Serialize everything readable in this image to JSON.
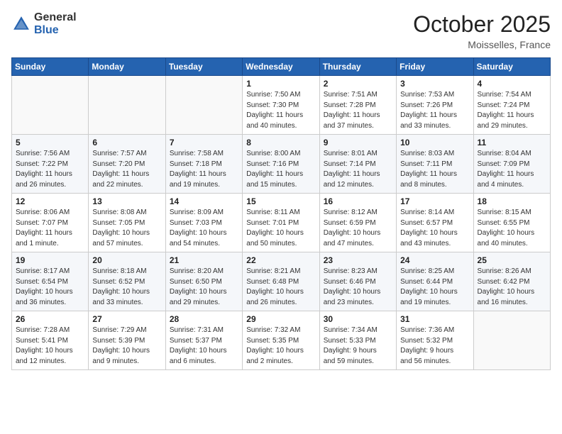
{
  "header": {
    "logo_general": "General",
    "logo_blue": "Blue",
    "month_title": "October 2025",
    "location": "Moisselles, France"
  },
  "weekdays": [
    "Sunday",
    "Monday",
    "Tuesday",
    "Wednesday",
    "Thursday",
    "Friday",
    "Saturday"
  ],
  "weeks": [
    [
      {
        "day": "",
        "info": ""
      },
      {
        "day": "",
        "info": ""
      },
      {
        "day": "",
        "info": ""
      },
      {
        "day": "1",
        "info": "Sunrise: 7:50 AM\nSunset: 7:30 PM\nDaylight: 11 hours\nand 40 minutes."
      },
      {
        "day": "2",
        "info": "Sunrise: 7:51 AM\nSunset: 7:28 PM\nDaylight: 11 hours\nand 37 minutes."
      },
      {
        "day": "3",
        "info": "Sunrise: 7:53 AM\nSunset: 7:26 PM\nDaylight: 11 hours\nand 33 minutes."
      },
      {
        "day": "4",
        "info": "Sunrise: 7:54 AM\nSunset: 7:24 PM\nDaylight: 11 hours\nand 29 minutes."
      }
    ],
    [
      {
        "day": "5",
        "info": "Sunrise: 7:56 AM\nSunset: 7:22 PM\nDaylight: 11 hours\nand 26 minutes."
      },
      {
        "day": "6",
        "info": "Sunrise: 7:57 AM\nSunset: 7:20 PM\nDaylight: 11 hours\nand 22 minutes."
      },
      {
        "day": "7",
        "info": "Sunrise: 7:58 AM\nSunset: 7:18 PM\nDaylight: 11 hours\nand 19 minutes."
      },
      {
        "day": "8",
        "info": "Sunrise: 8:00 AM\nSunset: 7:16 PM\nDaylight: 11 hours\nand 15 minutes."
      },
      {
        "day": "9",
        "info": "Sunrise: 8:01 AM\nSunset: 7:14 PM\nDaylight: 11 hours\nand 12 minutes."
      },
      {
        "day": "10",
        "info": "Sunrise: 8:03 AM\nSunset: 7:11 PM\nDaylight: 11 hours\nand 8 minutes."
      },
      {
        "day": "11",
        "info": "Sunrise: 8:04 AM\nSunset: 7:09 PM\nDaylight: 11 hours\nand 4 minutes."
      }
    ],
    [
      {
        "day": "12",
        "info": "Sunrise: 8:06 AM\nSunset: 7:07 PM\nDaylight: 11 hours\nand 1 minute."
      },
      {
        "day": "13",
        "info": "Sunrise: 8:08 AM\nSunset: 7:05 PM\nDaylight: 10 hours\nand 57 minutes."
      },
      {
        "day": "14",
        "info": "Sunrise: 8:09 AM\nSunset: 7:03 PM\nDaylight: 10 hours\nand 54 minutes."
      },
      {
        "day": "15",
        "info": "Sunrise: 8:11 AM\nSunset: 7:01 PM\nDaylight: 10 hours\nand 50 minutes."
      },
      {
        "day": "16",
        "info": "Sunrise: 8:12 AM\nSunset: 6:59 PM\nDaylight: 10 hours\nand 47 minutes."
      },
      {
        "day": "17",
        "info": "Sunrise: 8:14 AM\nSunset: 6:57 PM\nDaylight: 10 hours\nand 43 minutes."
      },
      {
        "day": "18",
        "info": "Sunrise: 8:15 AM\nSunset: 6:55 PM\nDaylight: 10 hours\nand 40 minutes."
      }
    ],
    [
      {
        "day": "19",
        "info": "Sunrise: 8:17 AM\nSunset: 6:54 PM\nDaylight: 10 hours\nand 36 minutes."
      },
      {
        "day": "20",
        "info": "Sunrise: 8:18 AM\nSunset: 6:52 PM\nDaylight: 10 hours\nand 33 minutes."
      },
      {
        "day": "21",
        "info": "Sunrise: 8:20 AM\nSunset: 6:50 PM\nDaylight: 10 hours\nand 29 minutes."
      },
      {
        "day": "22",
        "info": "Sunrise: 8:21 AM\nSunset: 6:48 PM\nDaylight: 10 hours\nand 26 minutes."
      },
      {
        "day": "23",
        "info": "Sunrise: 8:23 AM\nSunset: 6:46 PM\nDaylight: 10 hours\nand 23 minutes."
      },
      {
        "day": "24",
        "info": "Sunrise: 8:25 AM\nSunset: 6:44 PM\nDaylight: 10 hours\nand 19 minutes."
      },
      {
        "day": "25",
        "info": "Sunrise: 8:26 AM\nSunset: 6:42 PM\nDaylight: 10 hours\nand 16 minutes."
      }
    ],
    [
      {
        "day": "26",
        "info": "Sunrise: 7:28 AM\nSunset: 5:41 PM\nDaylight: 10 hours\nand 12 minutes."
      },
      {
        "day": "27",
        "info": "Sunrise: 7:29 AM\nSunset: 5:39 PM\nDaylight: 10 hours\nand 9 minutes."
      },
      {
        "day": "28",
        "info": "Sunrise: 7:31 AM\nSunset: 5:37 PM\nDaylight: 10 hours\nand 6 minutes."
      },
      {
        "day": "29",
        "info": "Sunrise: 7:32 AM\nSunset: 5:35 PM\nDaylight: 10 hours\nand 2 minutes."
      },
      {
        "day": "30",
        "info": "Sunrise: 7:34 AM\nSunset: 5:33 PM\nDaylight: 9 hours\nand 59 minutes."
      },
      {
        "day": "31",
        "info": "Sunrise: 7:36 AM\nSunset: 5:32 PM\nDaylight: 9 hours\nand 56 minutes."
      },
      {
        "day": "",
        "info": ""
      }
    ]
  ]
}
